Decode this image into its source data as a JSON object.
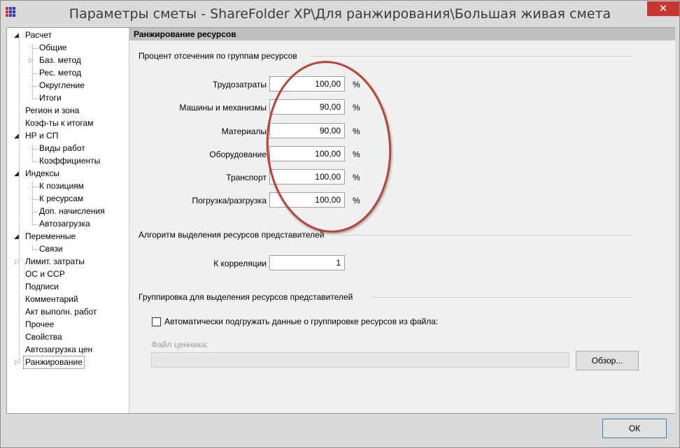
{
  "window": {
    "title": "Параметры сметы - ShareFolder XP\\Для ранжирования\\Большая живая смета",
    "close_label": "✕"
  },
  "tree": {
    "items": [
      {
        "label": "Расчет"
      },
      {
        "label": "Общие"
      },
      {
        "label": "Баз. метод"
      },
      {
        "label": "Рес. метод"
      },
      {
        "label": "Округление"
      },
      {
        "label": "Итоги"
      },
      {
        "label": "Регион и зона"
      },
      {
        "label": "Коэф-ты к итогам"
      },
      {
        "label": "НР и СП"
      },
      {
        "label": "Виды работ"
      },
      {
        "label": "Коэффициенты"
      },
      {
        "label": "Индексы"
      },
      {
        "label": "К позициям"
      },
      {
        "label": "К ресурсам"
      },
      {
        "label": "Доп. начисления"
      },
      {
        "label": "Автозагрузка"
      },
      {
        "label": "Переменные"
      },
      {
        "label": "Связи"
      },
      {
        "label": "Лимит. затраты"
      },
      {
        "label": "ОС и ССР"
      },
      {
        "label": "Подписи"
      },
      {
        "label": "Комментарий"
      },
      {
        "label": "Акт выполн. работ"
      },
      {
        "label": "Прочее"
      },
      {
        "label": "Свойства"
      },
      {
        "label": "Автозагрузка цен"
      },
      {
        "label": "Ранжирование"
      }
    ]
  },
  "panel": {
    "header": "Ранжирование ресурсов",
    "cutoff_group": {
      "title": "Процент отсечения по группам ресурсов",
      "unit": "%",
      "rows": [
        {
          "label": "Трудозатраты",
          "value": "100,00"
        },
        {
          "label": "Машины и механизмы",
          "value": "90,00"
        },
        {
          "label": "Материалы",
          "value": "90,00"
        },
        {
          "label": "Оборудование",
          "value": "100,00"
        },
        {
          "label": "Транспорт",
          "value": "100,00"
        },
        {
          "label": "Погрузка/разгрузка",
          "value": "100,00"
        }
      ]
    },
    "algorithm_group": {
      "title": "Алгоритм выделения ресурсов представителей",
      "correlation_label": "К корреляции",
      "correlation_value": "1"
    },
    "grouping_group": {
      "title": "Группировка для выделения ресурсов представителей",
      "auto_load_label": "Автоматически подгружать данные о группировке ресурсов из файла:",
      "auto_load_checked": false,
      "file_label": "Файл ценника:",
      "file_value": "",
      "browse_label": "Обзор..."
    }
  },
  "footer": {
    "ok_label": "ОК"
  },
  "colors": {
    "annotation": "#b54339",
    "header_bg": "#c0c0c0",
    "close_bg": "#c7372f"
  }
}
